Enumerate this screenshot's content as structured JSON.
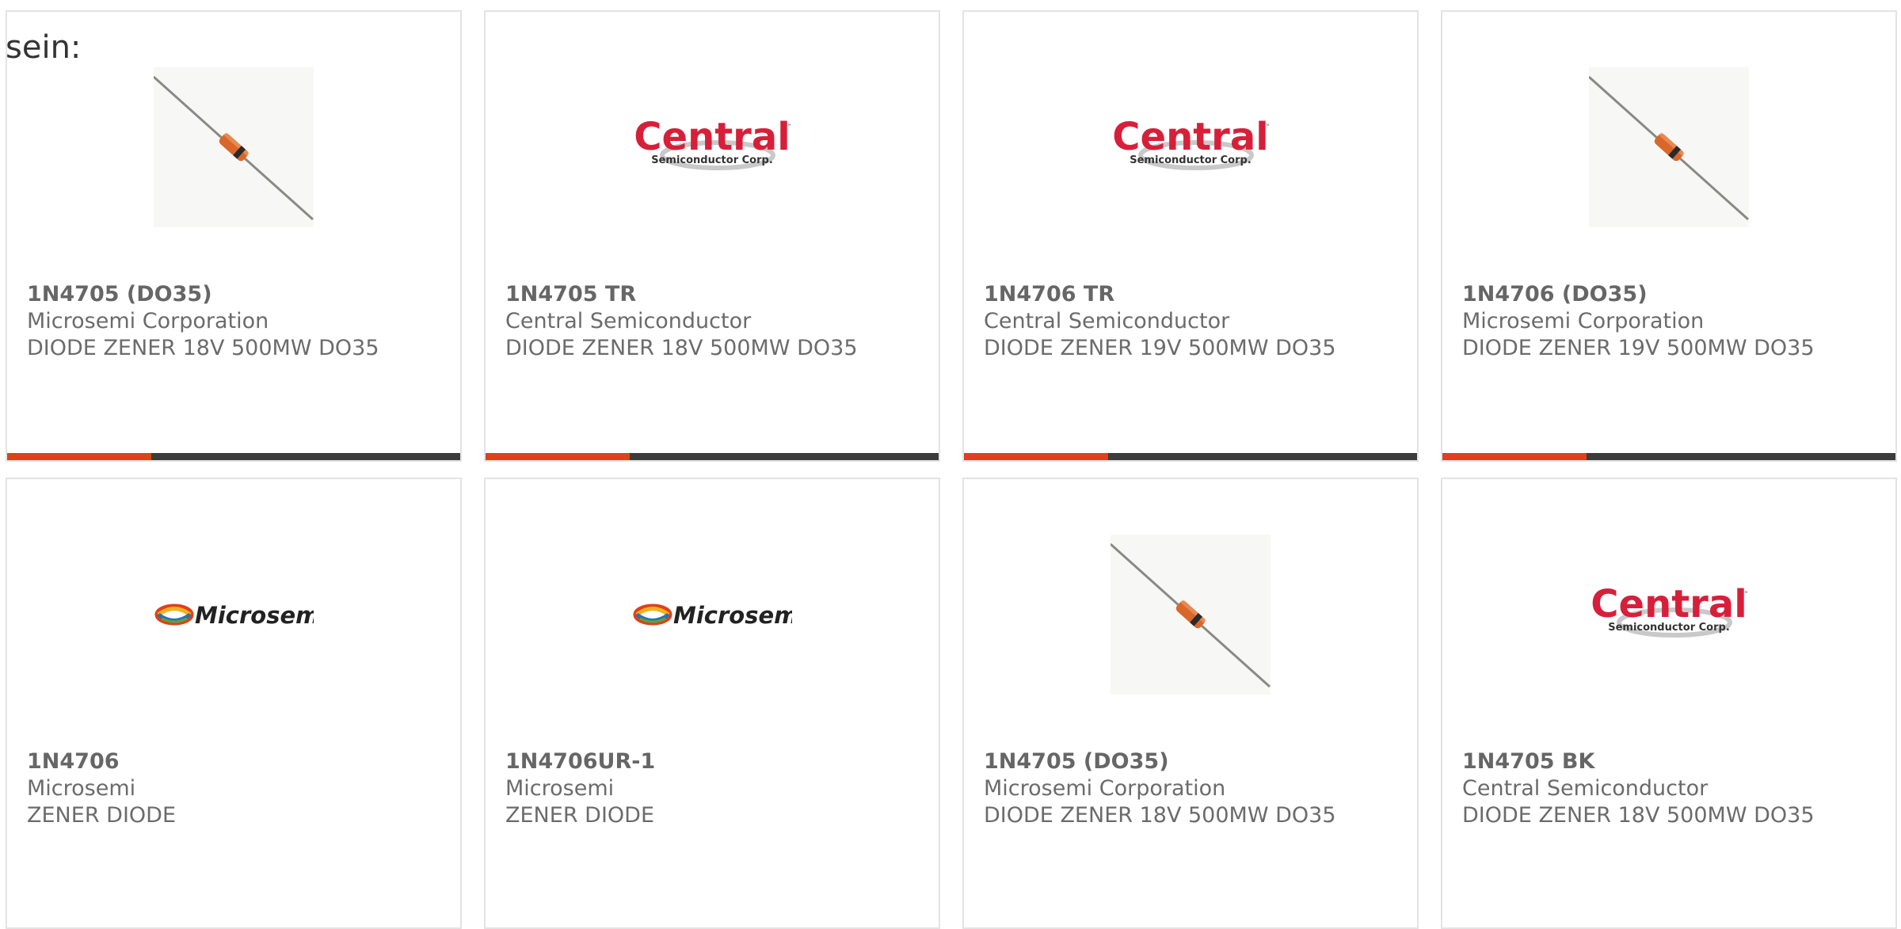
{
  "intro_text": "sein:",
  "colors": {
    "accent": "#e0401a",
    "bar_dark": "#3c3c3c",
    "central_red": "#d81f3a",
    "text_gray": "#666666"
  },
  "cards": [
    {
      "part": "1N4705 (DO35)",
      "manufacturer": "Microsemi Corporation",
      "description": "DIODE ZENER 18V 500MW DO35",
      "image": "diode-icon"
    },
    {
      "part": "1N4705 TR",
      "manufacturer": "Central Semiconductor",
      "description": "DIODE ZENER 18V 500MW DO35",
      "image": "central-logo"
    },
    {
      "part": "1N4706 TR",
      "manufacturer": "Central Semiconductor",
      "description": "DIODE ZENER 19V 500MW DO35",
      "image": "central-logo"
    },
    {
      "part": "1N4706 (DO35)",
      "manufacturer": "Microsemi Corporation",
      "description": "DIODE ZENER 19V 500MW DO35",
      "image": "diode-icon"
    },
    {
      "part": "1N4706",
      "manufacturer": "Microsemi",
      "description": "ZENER DIODE",
      "image": "microsemi-logo"
    },
    {
      "part": "1N4706UR-1",
      "manufacturer": "Microsemi",
      "description": "ZENER DIODE",
      "image": "microsemi-logo"
    },
    {
      "part": "1N4705 (DO35)",
      "manufacturer": "Microsemi Corporation",
      "description": "DIODE ZENER 18V 500MW DO35",
      "image": "diode-icon"
    },
    {
      "part": "1N4705 BK",
      "manufacturer": "Central Semiconductor",
      "description": "DIODE ZENER 18V 500MW DO35",
      "image": "central-logo"
    }
  ],
  "logos": {
    "central": {
      "word": "Central",
      "sub": "Semiconductor Corp.",
      "tm": "™"
    },
    "microsemi": {
      "word": "Microsemi"
    }
  }
}
